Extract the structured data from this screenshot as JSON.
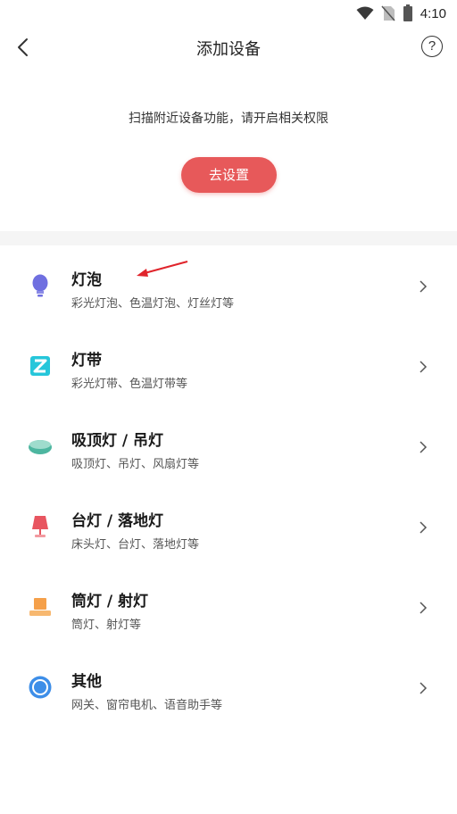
{
  "status_bar": {
    "time": "4:10",
    "icons": [
      "wifi-icon",
      "no-sim-icon",
      "battery-icon"
    ]
  },
  "header": {
    "title": "添加设备",
    "back_icon": "back-arrow-icon",
    "help_label": "?"
  },
  "scan": {
    "hint": "扫描附近设备功能，请开启相关权限",
    "button_label": "去设置",
    "button_color": "#e7595a"
  },
  "devices": [
    {
      "name": "灯泡",
      "desc": "彩光灯泡、色温灯泡、灯丝灯等",
      "icon": "bulb-icon",
      "color": "#6f6fe0"
    },
    {
      "name": "灯带",
      "desc": "彩光灯带、色温灯带等",
      "icon": "light-strip-icon",
      "color": "#26c6da"
    },
    {
      "name": "吸顶灯 / 吊灯",
      "desc": "吸顶灯、吊灯、风扇灯等",
      "icon": "ceiling-light-icon",
      "color": "#4db6a0"
    },
    {
      "name": "台灯 / 落地灯",
      "desc": "床头灯、台灯、落地灯等",
      "icon": "desk-lamp-icon",
      "color": "#e85560"
    },
    {
      "name": "筒灯 / 射灯",
      "desc": "筒灯、射灯等",
      "icon": "downlight-icon",
      "color": "#f5a04a"
    },
    {
      "name": "其他",
      "desc": "网关、窗帘电机、语音助手等",
      "icon": "other-device-icon",
      "color": "#3d8ee8"
    }
  ],
  "annotation": {
    "arrow_color": "#e0242b"
  }
}
